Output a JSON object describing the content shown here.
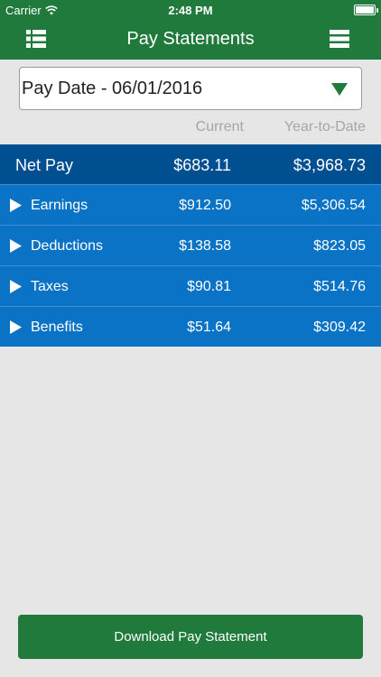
{
  "status_bar": {
    "carrier": "Carrier",
    "time": "2:48 PM"
  },
  "nav": {
    "title": "Pay Statements",
    "left_icon": "list-view-icon",
    "right_icon": "menu-icon"
  },
  "pay_date_select": {
    "value": "Pay Date - 06/01/2016"
  },
  "columns": {
    "current": "Current",
    "ytd": "Year-to-Date"
  },
  "net_pay": {
    "label": "Net Pay",
    "current": "$683.11",
    "ytd": "$3,968.73"
  },
  "rows": [
    {
      "label": "Earnings",
      "current": "$912.50",
      "ytd": "$5,306.54"
    },
    {
      "label": "Deductions",
      "current": "$138.58",
      "ytd": "$823.05"
    },
    {
      "label": "Taxes",
      "current": "$90.81",
      "ytd": "$514.76"
    },
    {
      "label": "Benefits",
      "current": "$51.64",
      "ytd": "$309.42"
    }
  ],
  "download_button": {
    "label": "Download Pay Statement"
  },
  "colors": {
    "brand_green": "#1f7a3c",
    "net_pay_bg": "#004f91",
    "row_bg": "#0a73c5",
    "background": "#e6e6e6"
  }
}
